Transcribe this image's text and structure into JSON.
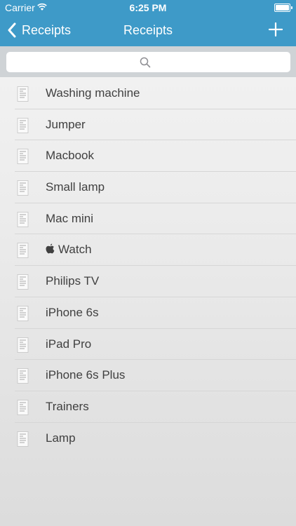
{
  "status_bar": {
    "carrier": "Carrier",
    "time": "6:25 PM"
  },
  "nav": {
    "back_label": "Receipts",
    "title": "Receipts"
  },
  "search": {
    "placeholder": "",
    "value": ""
  },
  "receipts": [
    "Washing machine",
    "Jumper",
    "Macbook",
    "Small lamp",
    "Mac mini",
    "Watch",
    "Philips TV",
    "iPhone 6s",
    "iPad Pro",
    "iPhone 6s Plus",
    "Trainers",
    "Lamp"
  ],
  "icons": {
    "back": "chevron-left-icon",
    "add": "plus-icon",
    "search": "magnifier-icon",
    "receipt": "receipt-thumbnail-icon",
    "watch_prefix": "apple-logo-icon"
  },
  "colors": {
    "nav_bar": "#3e9ac8",
    "search_bar": "#cfd3d6",
    "text": "#404040"
  }
}
